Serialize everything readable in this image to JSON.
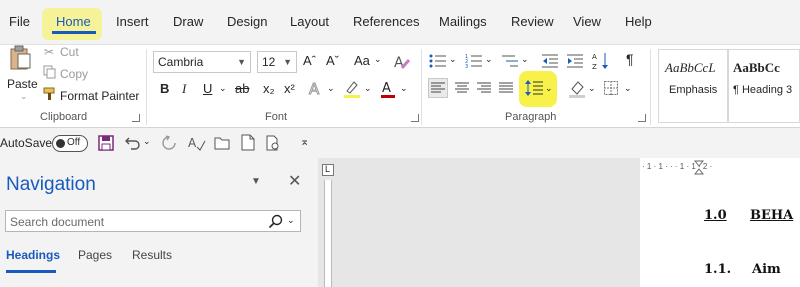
{
  "menu": {
    "tabs": [
      "File",
      "Home",
      "Insert",
      "Draw",
      "Design",
      "Layout",
      "References",
      "Mailings",
      "Review",
      "View",
      "Help"
    ],
    "active": "Home"
  },
  "clipboard": {
    "paste": "Paste",
    "cut": "Cut",
    "copy": "Copy",
    "format_painter": "Format Painter",
    "label": "Clipboard"
  },
  "font": {
    "name": "Cambria",
    "size": "12",
    "grow": "Aˆ",
    "shrink": "Aˇ",
    "case": "Aa",
    "bold": "B",
    "italic": "I",
    "underline": "U",
    "strike": "ab",
    "subscript": "x₂",
    "superscript": "x²",
    "label": "Font"
  },
  "paragraph": {
    "label": "Paragraph"
  },
  "styles": {
    "items": [
      {
        "preview": "AaBbCcL",
        "name": "Emphasis"
      },
      {
        "preview": "AaBbCc",
        "name": "¶ Heading 3"
      }
    ]
  },
  "qat": {
    "autosave": "AutoSave",
    "toggle": "Off"
  },
  "navigation": {
    "title": "Navigation",
    "search_placeholder": "Search document",
    "tabs": [
      "Headings",
      "Pages",
      "Results"
    ]
  },
  "ruler": {
    "text": "· 1 · 1 · · · 1 · 1 · 2 ·"
  },
  "document": {
    "headings": [
      {
        "num": "1.0",
        "text": "BEHA"
      },
      {
        "num": "1.1.",
        "text": "Aim"
      }
    ]
  },
  "colors": {
    "accent": "#185abd",
    "highlight": "#f7f14a",
    "font_red": "#c00000"
  }
}
